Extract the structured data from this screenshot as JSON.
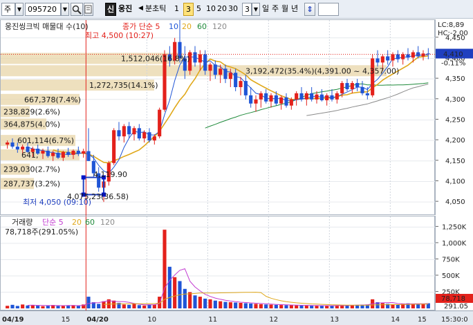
{
  "toolbar": {
    "market": "주",
    "code": "095720",
    "search_icon": "magnifier-icon",
    "badge": "신",
    "stock_name": "웅진",
    "tick_label": "분초틱",
    "intervals": [
      "1",
      "3",
      "5",
      "10",
      "20",
      "30"
    ],
    "selected_interval": "3",
    "count_value": "3",
    "periods": [
      "일",
      "주",
      "월",
      "년"
    ],
    "updown_icon": "up-down-arrow-icon"
  },
  "price_panel": {
    "title": "웅진씽크빅 매물대 수(10)",
    "ma_title": "종가 단순 5",
    "ma_periods": [
      "10",
      "20",
      "60",
      "120"
    ],
    "high_label": "최고 4,500 (10:27)",
    "low_label": "최저 4,050 (09:10)",
    "corner_lc": "LC:8,89",
    "corner_hc": "HC:-2,00",
    "current_price": "4,410",
    "current_change": "-0.11%",
    "box_label_1": "4,075,23(36.58)",
    "box_label_2": "4,119.90"
  },
  "volume_panel": {
    "title": "거래량",
    "ma_title": "단순 5",
    "ma_periods": [
      "20",
      "60",
      "120"
    ],
    "value_label": "78,718주(291.05%)",
    "current_volume": "78,718",
    "current_ratio": "291.05"
  },
  "volume_profile": [
    {
      "label": "1,512,046(16.8%)",
      "price": 4400,
      "fraction": 0.44
    },
    {
      "label": "3,192,472(35.4%)(4,391.00 ~ 4,357.00)",
      "price": 4370,
      "fraction": 0.93
    },
    {
      "label": "1,272,735(14.1%)",
      "price": 4335,
      "fraction": 0.37
    },
    {
      "label": "667,378(7.4%)",
      "price": 4300,
      "fraction": 0.19
    },
    {
      "label": "238,829(2.6%)",
      "price": 4270,
      "fraction": 0.07
    },
    {
      "label": "364,875(4.0%)",
      "price": 4240,
      "fraction": 0.11
    },
    {
      "label": "601,114(6.7%)",
      "price": 4200,
      "fraction": 0.18
    },
    {
      "label": "641,",
      "price": 4165,
      "fraction": 0.19
    },
    {
      "label": "239,030(2.7%)",
      "price": 4130,
      "fraction": 0.07
    },
    {
      "label": "287,737(3.2%)",
      "price": 4095,
      "fraction": 0.08
    }
  ],
  "price_axis_ticks": [
    "4,450",
    "4,400",
    "4,350",
    "4,300",
    "4,250",
    "4,200",
    "4,150",
    "4,100",
    "4,050"
  ],
  "volume_axis_ticks": [
    "1,250K",
    "1,000K",
    "750K",
    "500K",
    "250K"
  ],
  "time_axis": {
    "labels": [
      "04/19",
      "15",
      "04/20",
      "10",
      "11",
      "12",
      "13",
      "14",
      "15"
    ],
    "right_label": "15:30:0"
  },
  "colors": {
    "up": "#e3211b",
    "down": "#1f55d6",
    "ma5": "#e3211b",
    "ma10": "#1f55d6",
    "ma20": "#e0a81a",
    "ma60": "#1e8a3a",
    "ma120": "#8a8a8a",
    "profile": "#e8d6a8"
  },
  "chart_data": {
    "type": "candlestick",
    "title": "웅진씽크빅 매물대 수(10)",
    "ylim": [
      4030,
      4480
    ],
    "high": 4500,
    "low": 4050,
    "candles": [
      [
        4190,
        4200,
        4180,
        4195
      ],
      [
        4195,
        4205,
        4180,
        4185
      ],
      [
        4185,
        4195,
        4170,
        4178
      ],
      [
        4178,
        4190,
        4165,
        4185
      ],
      [
        4185,
        4195,
        4170,
        4172
      ],
      [
        4172,
        4185,
        4160,
        4180
      ],
      [
        4180,
        4190,
        4165,
        4168
      ],
      [
        4168,
        4180,
        4155,
        4175
      ],
      [
        4175,
        4185,
        4158,
        4162
      ],
      [
        4162,
        4175,
        4150,
        4170
      ],
      [
        4170,
        4180,
        4155,
        4158
      ],
      [
        4158,
        4175,
        4150,
        4172
      ],
      [
        4172,
        4182,
        4160,
        4165
      ],
      [
        4165,
        4178,
        4155,
        4175
      ],
      [
        4175,
        4185,
        4162,
        4168
      ],
      [
        4168,
        4180,
        4158,
        4174
      ],
      [
        4174,
        4230,
        4150,
        4150
      ],
      [
        4150,
        4165,
        4110,
        4120
      ],
      [
        4120,
        4135,
        4075,
        4085
      ],
      [
        4085,
        4110,
        4050,
        4100
      ],
      [
        4100,
        4150,
        4090,
        4145
      ],
      [
        4145,
        4230,
        4140,
        4225
      ],
      [
        4225,
        4245,
        4200,
        4210
      ],
      [
        4210,
        4240,
        4195,
        4235
      ],
      [
        4235,
        4245,
        4205,
        4215
      ],
      [
        4215,
        4235,
        4200,
        4230
      ],
      [
        4230,
        4240,
        4200,
        4205
      ],
      [
        4205,
        4225,
        4195,
        4220
      ],
      [
        4220,
        4230,
        4195,
        4200
      ],
      [
        4200,
        4215,
        4190,
        4210
      ],
      [
        4210,
        4280,
        4205,
        4275
      ],
      [
        4275,
        4420,
        4270,
        4410
      ],
      [
        4410,
        4430,
        4380,
        4395
      ],
      [
        4395,
        4450,
        4385,
        4440
      ],
      [
        4440,
        4500,
        4390,
        4400
      ],
      [
        4400,
        4430,
        4350,
        4370
      ],
      [
        4370,
        4420,
        4360,
        4415
      ],
      [
        4415,
        4430,
        4380,
        4390
      ],
      [
        4390,
        4420,
        4370,
        4410
      ],
      [
        4410,
        4420,
        4360,
        4370
      ],
      [
        4370,
        4390,
        4345,
        4385
      ],
      [
        4385,
        4395,
        4350,
        4360
      ],
      [
        4360,
        4385,
        4340,
        4375
      ],
      [
        4375,
        4385,
        4340,
        4350
      ],
      [
        4350,
        4375,
        4330,
        4365
      ],
      [
        4365,
        4375,
        4320,
        4330
      ],
      [
        4330,
        4355,
        4310,
        4345
      ],
      [
        4345,
        4360,
        4300,
        4310
      ],
      [
        4310,
        4330,
        4280,
        4290
      ],
      [
        4290,
        4310,
        4270,
        4300
      ],
      [
        4300,
        4320,
        4280,
        4315
      ],
      [
        4315,
        4325,
        4290,
        4295
      ],
      [
        4295,
        4315,
        4280,
        4310
      ],
      [
        4310,
        4320,
        4285,
        4290
      ],
      [
        4290,
        4310,
        4275,
        4305
      ],
      [
        4305,
        4315,
        4280,
        4285
      ],
      [
        4285,
        4305,
        4275,
        4300
      ],
      [
        4300,
        4320,
        4285,
        4315
      ],
      [
        4315,
        4330,
        4295,
        4300
      ],
      [
        4300,
        4320,
        4285,
        4315
      ],
      [
        4315,
        4330,
        4295,
        4300
      ],
      [
        4300,
        4320,
        4290,
        4312
      ],
      [
        4312,
        4325,
        4295,
        4298
      ],
      [
        4298,
        4315,
        4285,
        4310
      ],
      [
        4310,
        4325,
        4295,
        4300
      ],
      [
        4300,
        4320,
        4290,
        4315
      ],
      [
        4315,
        4345,
        4305,
        4340
      ],
      [
        4340,
        4350,
        4320,
        4325
      ],
      [
        4325,
        4345,
        4315,
        4340
      ],
      [
        4340,
        4350,
        4320,
        4330
      ],
      [
        4330,
        4345,
        4310,
        4315
      ],
      [
        4315,
        4330,
        4300,
        4310
      ],
      [
        4310,
        4410,
        4305,
        4400
      ],
      [
        4400,
        4420,
        4380,
        4390
      ],
      [
        4390,
        4410,
        4370,
        4405
      ],
      [
        4405,
        4420,
        4385,
        4395
      ],
      [
        4395,
        4415,
        4380,
        4410
      ],
      [
        4410,
        4420,
        4390,
        4398
      ],
      [
        4398,
        4415,
        4385,
        4410
      ],
      [
        4410,
        4425,
        4395,
        4402
      ],
      [
        4402,
        4420,
        4390,
        4415
      ],
      [
        4415,
        4430,
        4400,
        4405
      ],
      [
        4405,
        4420,
        4395,
        4412
      ],
      [
        4412,
        4425,
        4398,
        4410
      ]
    ],
    "volumes": [
      40,
      55,
      38,
      60,
      45,
      50,
      42,
      35,
      48,
      52,
      40,
      38,
      45,
      50,
      42,
      60,
      180,
      95,
      70,
      110,
      140,
      120,
      85,
      60,
      55,
      70,
      50,
      45,
      60,
      55,
      180,
      1210,
      640,
      480,
      420,
      300,
      250,
      200,
      180,
      150,
      140,
      120,
      110,
      100,
      95,
      90,
      85,
      80,
      75,
      70,
      65,
      60,
      58,
      55,
      52,
      50,
      48,
      46,
      45,
      44,
      43,
      42,
      41,
      40,
      42,
      45,
      48,
      50,
      52,
      55,
      58,
      60,
      140,
      95,
      80,
      70,
      65,
      60,
      75,
      78,
      72,
      70,
      68,
      79
    ]
  }
}
